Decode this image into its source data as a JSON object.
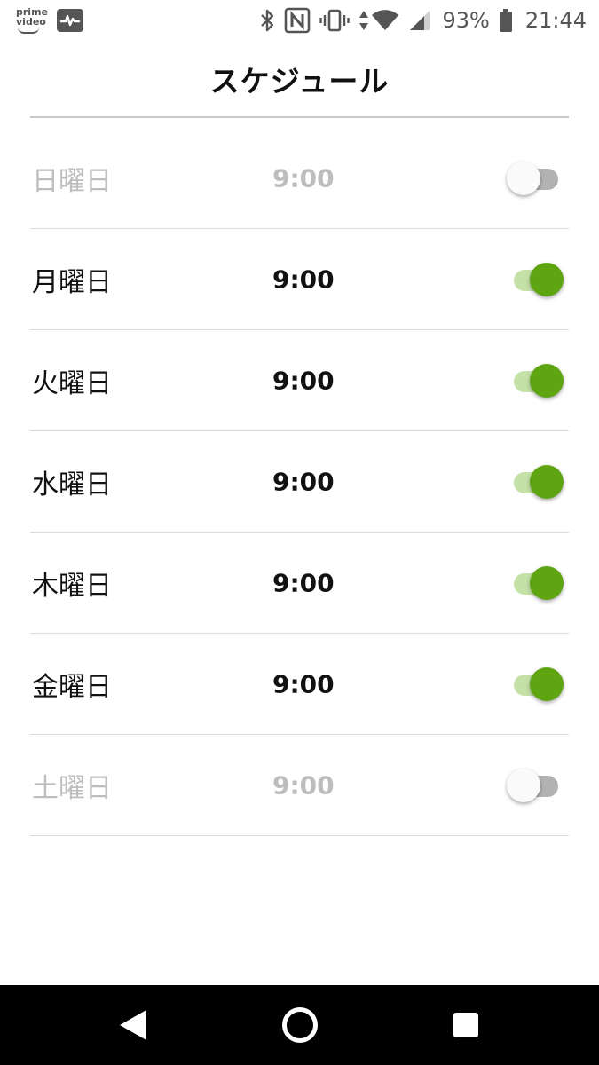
{
  "status_bar": {
    "prime_line1": "prime",
    "prime_line2": "video",
    "battery_percent": "93%",
    "time": "21:44",
    "icons": [
      "amazon-prime-video-icon",
      "activity-monitor-icon",
      "bluetooth-icon",
      "nfc-icon",
      "vibrate-icon",
      "data-transfer-icon",
      "wifi-icon",
      "cellular-signal-icon",
      "battery-icon"
    ]
  },
  "header": {
    "title": "スケジュール"
  },
  "schedule": [
    {
      "day": "日曜日",
      "time": "9:00",
      "enabled": false
    },
    {
      "day": "月曜日",
      "time": "9:00",
      "enabled": true
    },
    {
      "day": "火曜日",
      "time": "9:00",
      "enabled": true
    },
    {
      "day": "水曜日",
      "time": "9:00",
      "enabled": true
    },
    {
      "day": "木曜日",
      "time": "9:00",
      "enabled": true
    },
    {
      "day": "金曜日",
      "time": "9:00",
      "enabled": true
    },
    {
      "day": "土曜日",
      "time": "9:00",
      "enabled": false
    }
  ],
  "colors": {
    "accent": "#5fa512",
    "accent_track": "#c4e1a8",
    "disabled_text": "#bdbdbd",
    "text": "#111111",
    "nav_bar": "#000000"
  },
  "nav_bar": {
    "icons": [
      "back-icon",
      "home-icon",
      "recents-icon"
    ]
  }
}
